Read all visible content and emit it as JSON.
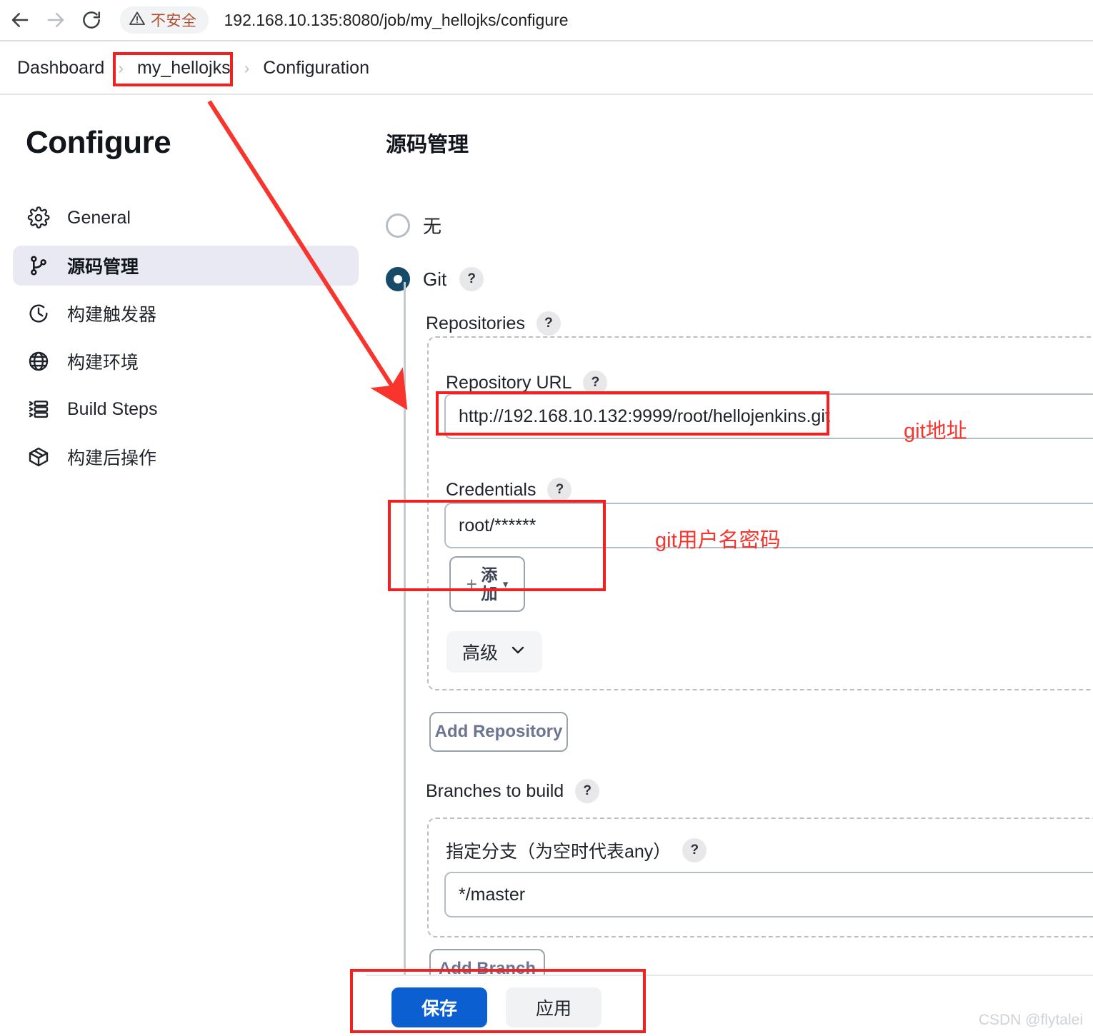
{
  "browser": {
    "back_icon": "arrow-left-icon",
    "forward_icon": "arrow-right-icon",
    "reload_icon": "reload-icon",
    "security_icon": "warning-triangle-icon",
    "security_label": "不安全",
    "url": "192.168.10.135:8080/job/my_hellojks/configure"
  },
  "breadcrumb": {
    "items": [
      {
        "label": "Dashboard"
      },
      {
        "label": "my_hellojks"
      },
      {
        "label": "Configuration"
      }
    ],
    "separator": "›"
  },
  "sidebar": {
    "title": "Configure",
    "items": [
      {
        "label": "General",
        "icon": "gear-icon",
        "active": false
      },
      {
        "label": "源码管理",
        "icon": "git-branch-icon",
        "active": true
      },
      {
        "label": "构建触发器",
        "icon": "clock-icon",
        "active": false
      },
      {
        "label": "构建环境",
        "icon": "globe-icon",
        "active": false
      },
      {
        "label": "Build Steps",
        "icon": "list-steps-icon",
        "active": false
      },
      {
        "label": "构建后操作",
        "icon": "package-icon",
        "active": false
      }
    ]
  },
  "main": {
    "section_title": "源码管理",
    "scm_options": [
      {
        "label": "无",
        "checked": false
      },
      {
        "label": "Git",
        "checked": true
      }
    ],
    "repositories_label": "Repositories",
    "repository_url_label": "Repository URL",
    "repository_url_value": "http://192.168.10.132:9999/root/hellojenkins.git",
    "credentials_label": "Credentials",
    "credentials_value": "root/******",
    "add_credentials_label": "添加",
    "add_credentials_plus": "+",
    "add_credentials_caret": "▾",
    "advanced_label": "高级",
    "advanced_caret": "chevron-down-icon",
    "add_repository_label": "Add Repository",
    "branches_label": "Branches to build",
    "branch_specifier_label": "指定分支（为空时代表any）",
    "branch_specifier_value": "*/master",
    "add_branch_label": "Add Branch",
    "help_glyph": "?"
  },
  "footer": {
    "save_label": "保存",
    "apply_label": "应用"
  },
  "annotations": {
    "git_url_note": "git地址",
    "credentials_note": "git用户名密码",
    "accent_color": "#f8342c"
  },
  "watermark": "CSDN @flytalei"
}
